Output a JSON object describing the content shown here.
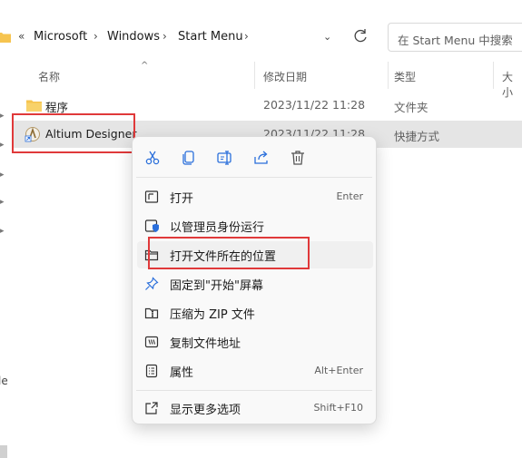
{
  "address": {
    "overflow": "«",
    "crumbs": [
      "Microsoft",
      "Windows",
      "Start Menu"
    ],
    "search_placeholder": "在 Start Menu 中搜索"
  },
  "columns": {
    "name": "名称",
    "modified": "修改日期",
    "type": "类型",
    "size": "大小"
  },
  "files": [
    {
      "name": "程序",
      "modified": "2023/11/22 11:28",
      "type": "文件夹"
    },
    {
      "name": "Altium Designer",
      "modified": "2023/11/22 11:28",
      "type": "快捷方式"
    }
  ],
  "left_pane_partial": "le",
  "context_menu": {
    "toolbar": [
      "cut-icon",
      "copy-icon",
      "rename-icon",
      "share-icon",
      "delete-icon"
    ],
    "items": [
      {
        "label": "打开",
        "shortcut": "Enter",
        "icon": "open-icon"
      },
      {
        "label": "以管理员身份运行",
        "shortcut": "",
        "icon": "shield-icon"
      },
      {
        "label": "打开文件所在的位置",
        "shortcut": "",
        "icon": "folder-icon"
      },
      {
        "label": "固定到\"开始\"屏幕",
        "shortcut": "",
        "icon": "pin-icon"
      },
      {
        "label": "压缩为 ZIP 文件",
        "shortcut": "",
        "icon": "zip-icon"
      },
      {
        "label": "复制文件地址",
        "shortcut": "",
        "icon": "copy-path-icon"
      },
      {
        "label": "属性",
        "shortcut": "Alt+Enter",
        "icon": "properties-icon"
      },
      {
        "label": "显示更多选项",
        "shortcut": "Shift+F10",
        "icon": "more-options-icon"
      }
    ]
  },
  "colors": {
    "highlight_box": "#e0393a",
    "accent": "#2a6fdb",
    "folder": "#f6c44f",
    "selection": "#e5e5e5"
  }
}
